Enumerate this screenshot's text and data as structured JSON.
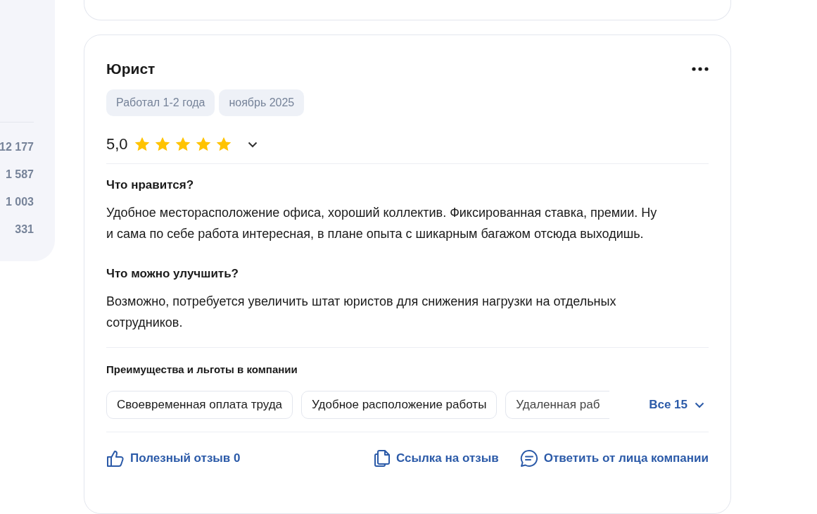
{
  "sidebar": {
    "counts": [
      "12 177",
      "1 587",
      "1 003",
      "331"
    ]
  },
  "review": {
    "title": "Юрист",
    "tags": [
      "Работал 1-2 года",
      "ноябрь 2025"
    ],
    "rating": "5,0",
    "stars": 5,
    "sections": [
      {
        "heading": "Что нравится?",
        "text": "Удобное месторасположение офиса, хороший коллектив. Фиксированная ставка, премии. Ну и сама по себе работа интересная, в плане опыта с шикарным багажом отсюда выходишь."
      },
      {
        "heading": "Что можно улучшить?",
        "text": "Возможно, потребуется увеличить штат юристов для снижения нагрузки на отдельных сотрудников."
      }
    ],
    "benefits": {
      "heading": "Преимущества и льготы в компании",
      "items": [
        "Своевременная оплата труда",
        "Удобное расположение работы",
        "Удаленная раб"
      ],
      "more": "Все 15"
    },
    "actions": [
      {
        "kind": "like",
        "label": "Полезный отзыв 0"
      },
      {
        "kind": "link",
        "label": "Ссылка на отзыв"
      },
      {
        "kind": "reply",
        "label": "Ответить от лица компании"
      }
    ]
  }
}
